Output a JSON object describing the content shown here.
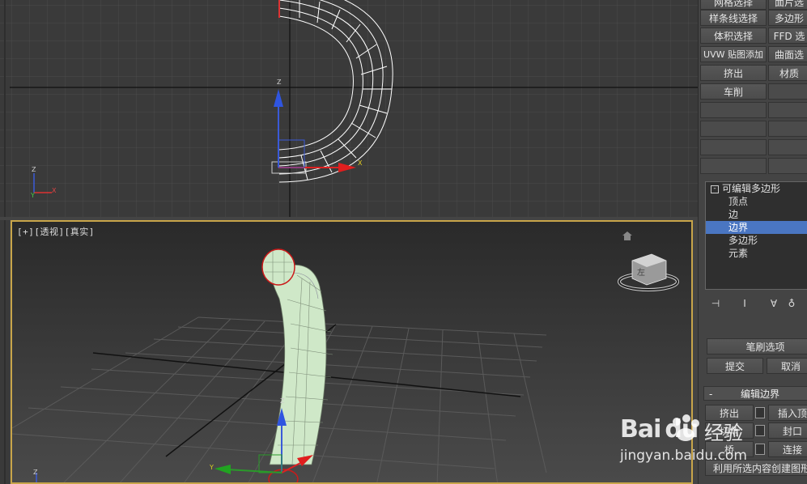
{
  "viewport_top": {
    "name": "top-viewport"
  },
  "viewport_persp": {
    "label_parts": [
      "[+]",
      "[透视]",
      "[真实]"
    ]
  },
  "command_panel": {
    "modifier_buttons": [
      {
        "left": "网格选择",
        "right": "面片选"
      },
      {
        "left": "样条线选择",
        "right": "多边形"
      },
      {
        "left": "体积选择",
        "right": "FFD 选"
      },
      {
        "left": "UVW 贴图添加",
        "right": "曲面选"
      },
      {
        "left": "挤出",
        "right": "材质"
      },
      {
        "left": "车削",
        "right": ""
      }
    ],
    "stack": {
      "root": "可编辑多边形",
      "root_icon": "minus-box-icon",
      "items": [
        "顶点",
        "边",
        "边界",
        "多边形",
        "元素"
      ],
      "selected": "边界"
    },
    "paint_section": {
      "brush_options": "笔刷选项",
      "commit": "提交",
      "cancel": "取消"
    },
    "edit_border": {
      "title": "编辑边界",
      "collapse_symbol": "-",
      "buttons": [
        {
          "left": "挤出",
          "right": "插入顶"
        },
        {
          "left": "切角",
          "right": "封口"
        },
        {
          "left": "桥",
          "right": "连接"
        }
      ],
      "create_shape": "利用所选内容创建图形"
    }
  },
  "watermark": {
    "logo": "Bai du",
    "jingyan": "经验",
    "url": "jingyan.baidu.com"
  },
  "colors": {
    "selection": "#4a76c2",
    "viewport_border": "#c8a54a",
    "mesh": "#cfe8c8"
  }
}
